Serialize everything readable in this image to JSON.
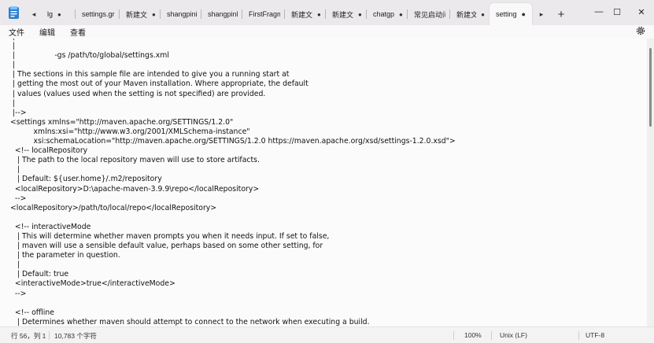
{
  "tabs": {
    "back_label": "◂",
    "items": [
      {
        "label": "lg",
        "dot": "●"
      },
      {
        "label": "settings.grac",
        "dot": ""
      },
      {
        "label": "新建文",
        "dot": "●"
      },
      {
        "label": "shangpiniter",
        "dot": ""
      },
      {
        "label": "shangpinRec",
        "dot": ""
      },
      {
        "label": "FirstFragmer",
        "dot": ""
      },
      {
        "label": "新建文",
        "dot": "●"
      },
      {
        "label": "新建文",
        "dot": "●"
      },
      {
        "label": "chatgp",
        "dot": "●"
      },
      {
        "label": "常见启动问题",
        "dot": ""
      },
      {
        "label": "新建文",
        "dot": "●"
      },
      {
        "label": "setting",
        "dot": "●"
      }
    ],
    "forward_label": "▸",
    "add_label": "+"
  },
  "window": {
    "minimize": "—",
    "maximize": "☐",
    "close": "✕"
  },
  "menu": {
    "file": "文件",
    "edit": "编辑",
    "view": "查看"
  },
  "editor": {
    "lines": [
      " |                                                                                                 ",
      " |",
      " |                 -gs /path/to/global/settings.xml",
      " |",
      " | The sections in this sample file are intended to give you a running start at",
      " | getting the most out of your Maven installation. Where appropriate, the default",
      " | values (values used when the setting is not specified) are provided.",
      " |",
      " |-->",
      "<settings xmlns=\"http://maven.apache.org/SETTINGS/1.2.0\"",
      "          xmlns:xsi=\"http://www.w3.org/2001/XMLSchema-instance\"",
      "          xsi:schemaLocation=\"http://maven.apache.org/SETTINGS/1.2.0 https://maven.apache.org/xsd/settings-1.2.0.xsd\">",
      "  <!-- localRepository",
      "   | The path to the local repository maven will use to store artifacts.",
      "   |",
      "   | Default: ${user.home}/.m2/repository",
      "  <localRepository>D:\\apache-maven-3.9.9\\repo</localRepository>",
      "  -->",
      "<localRepository>/path/to/local/repo</localRepository>",
      "",
      "  <!-- interactiveMode",
      "   | This will determine whether maven prompts you when it needs input. If set to false,",
      "   | maven will use a sensible default value, perhaps based on some other setting, for",
      "   | the parameter in question.",
      "   |",
      "   | Default: true",
      "  <interactiveMode>true</interactiveMode>",
      "  -->",
      "",
      "  <!-- offline",
      "   | Determines whether maven should attempt to connect to the network when executing a build."
    ]
  },
  "status": {
    "position": "行 56，列 1",
    "char_count": "10,783 个字符",
    "zoom": "100%",
    "line_ending": "Unix (LF)",
    "encoding": "UTF-8"
  },
  "colors": {
    "titlebar": "#ece9ec",
    "active_tab": "#f9f9f9",
    "editor_bg": "#fbfbfb"
  }
}
